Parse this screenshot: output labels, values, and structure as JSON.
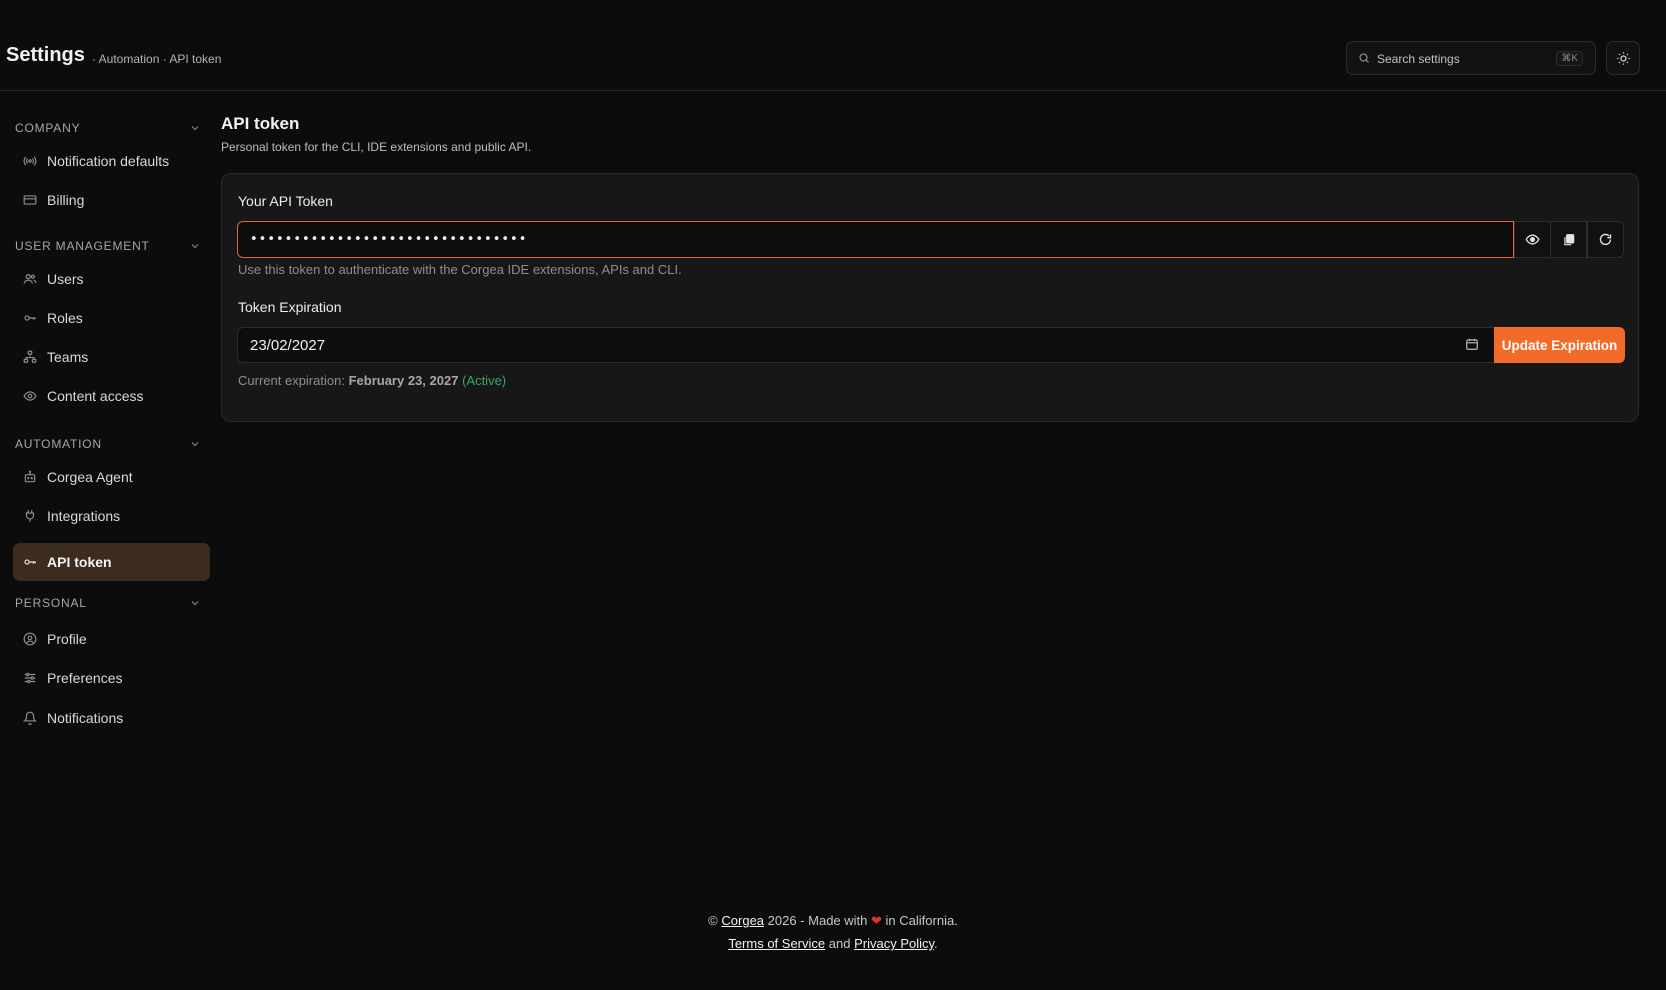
{
  "header": {
    "title": "Settings",
    "breadcrumb": "· Automation · API token",
    "search_placeholder": "Search settings",
    "search_shortcut": "⌘K",
    "theme_icon": "sun-icon"
  },
  "sidebar": {
    "groups": [
      {
        "label": "COMPANY",
        "items": [
          {
            "label": "Notification defaults",
            "icon": "broadcast-icon"
          },
          {
            "label": "Billing",
            "icon": "credit-card-icon"
          }
        ]
      },
      {
        "label": "USER MANAGEMENT",
        "items": [
          {
            "label": "Users",
            "icon": "users-icon"
          },
          {
            "label": "Roles",
            "icon": "key-icon"
          },
          {
            "label": "Teams",
            "icon": "org-chart-icon"
          },
          {
            "label": "Content access",
            "icon": "eye-icon"
          }
        ]
      },
      {
        "label": "AUTOMATION",
        "items": [
          {
            "label": "Corgea Agent",
            "icon": "robot-icon"
          },
          {
            "label": "Integrations",
            "icon": "plug-icon"
          },
          {
            "label": "API token",
            "icon": "key-icon",
            "active": true
          }
        ]
      },
      {
        "label": "PERSONAL",
        "items": [
          {
            "label": "Profile",
            "icon": "user-circle-icon"
          },
          {
            "label": "Preferences",
            "icon": "sliders-icon"
          },
          {
            "label": "Notifications",
            "icon": "bell-icon"
          }
        ]
      }
    ]
  },
  "main": {
    "title": "API token",
    "subtitle": "Personal token for the CLI, IDE extensions and public API.",
    "token": {
      "label": "Your API Token",
      "masked_value": "••••••••••••••••••••••••••••••••",
      "help": "Use this token to authenticate with the Corgea IDE extensions, APIs and CLI."
    },
    "expiration": {
      "label": "Token Expiration",
      "value": "23/02/2027",
      "button": "Update Expiration",
      "current_prefix": "Current expiration:",
      "current_date": "February 23, 2027",
      "status": "(Active)"
    }
  },
  "footer": {
    "copyright": "©",
    "brand": "Corgea",
    "made_with": "2026 - Made with",
    "heart": "❤",
    "location": "in California.",
    "terms": "Terms of Service",
    "and": "and",
    "privacy": "Privacy Policy",
    "period": "."
  },
  "colors": {
    "accent": "#f26b28",
    "active_nav": "#3c2c20",
    "status_active": "#3aa66e"
  }
}
